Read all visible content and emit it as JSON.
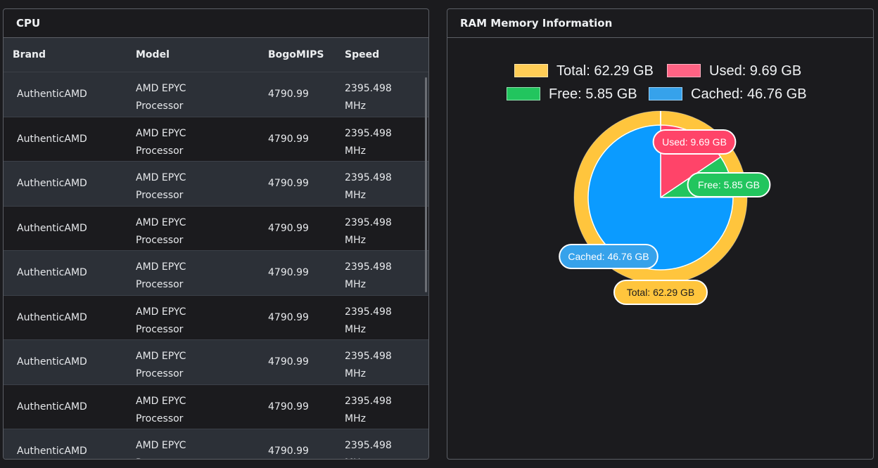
{
  "cpu": {
    "title": "CPU",
    "columns": [
      "Brand",
      "Model",
      "BogoMIPS",
      "Speed"
    ],
    "rows": [
      {
        "brand": "AuthenticAMD",
        "model_line1": "AMD EPYC",
        "model_line2": "Processor",
        "bogomips": "4790.99",
        "speed_line1": "2395.498",
        "speed_line2": "MHz"
      },
      {
        "brand": "AuthenticAMD",
        "model_line1": "AMD EPYC",
        "model_line2": "Processor",
        "bogomips": "4790.99",
        "speed_line1": "2395.498",
        "speed_line2": "MHz"
      },
      {
        "brand": "AuthenticAMD",
        "model_line1": "AMD EPYC",
        "model_line2": "Processor",
        "bogomips": "4790.99",
        "speed_line1": "2395.498",
        "speed_line2": "MHz"
      },
      {
        "brand": "AuthenticAMD",
        "model_line1": "AMD EPYC",
        "model_line2": "Processor",
        "bogomips": "4790.99",
        "speed_line1": "2395.498",
        "speed_line2": "MHz"
      },
      {
        "brand": "AuthenticAMD",
        "model_line1": "AMD EPYC",
        "model_line2": "Processor",
        "bogomips": "4790.99",
        "speed_line1": "2395.498",
        "speed_line2": "MHz"
      },
      {
        "brand": "AuthenticAMD",
        "model_line1": "AMD EPYC",
        "model_line2": "Processor",
        "bogomips": "4790.99",
        "speed_line1": "2395.498",
        "speed_line2": "MHz"
      },
      {
        "brand": "AuthenticAMD",
        "model_line1": "AMD EPYC",
        "model_line2": "Processor",
        "bogomips": "4790.99",
        "speed_line1": "2395.498",
        "speed_line2": "MHz"
      },
      {
        "brand": "AuthenticAMD",
        "model_line1": "AMD EPYC",
        "model_line2": "Processor",
        "bogomips": "4790.99",
        "speed_line1": "2395.498",
        "speed_line2": "MHz"
      },
      {
        "brand": "AuthenticAMD",
        "model_line1": "AMD EPYC",
        "model_line2": "Processor",
        "bogomips": "4790.99",
        "speed_line1": "2395.498",
        "speed_line2": "MHz"
      }
    ]
  },
  "ram": {
    "title": "RAM Memory Information",
    "legend": [
      {
        "label": "Total: 62.29 GB",
        "color": "#ffcd56"
      },
      {
        "label": "Used: 9.69 GB",
        "color": "#ff6384"
      },
      {
        "label": "Free: 5.85 GB",
        "color": "#22c55e"
      },
      {
        "label": "Cached: 46.76 GB",
        "color": "#36a2eb"
      }
    ]
  },
  "chart_data": {
    "type": "pie",
    "title": "",
    "outer_series": [
      {
        "name": "Total",
        "value": 62.29,
        "unit": "GB",
        "label": "Total: 62.29 GB",
        "color": "#ffc53d"
      }
    ],
    "inner_series": [
      {
        "name": "Used",
        "value": 9.69,
        "unit": "GB",
        "label": "Used: 9.69 GB",
        "color": "#ff4469"
      },
      {
        "name": "Free",
        "value": 5.85,
        "unit": "GB",
        "label": "Free: 5.85 GB",
        "color": "#22c55e"
      },
      {
        "name": "Cached",
        "value": 46.76,
        "unit": "GB",
        "label": "Cached: 46.76 GB",
        "color": "#0b9bff"
      }
    ],
    "legend_position": "top"
  }
}
